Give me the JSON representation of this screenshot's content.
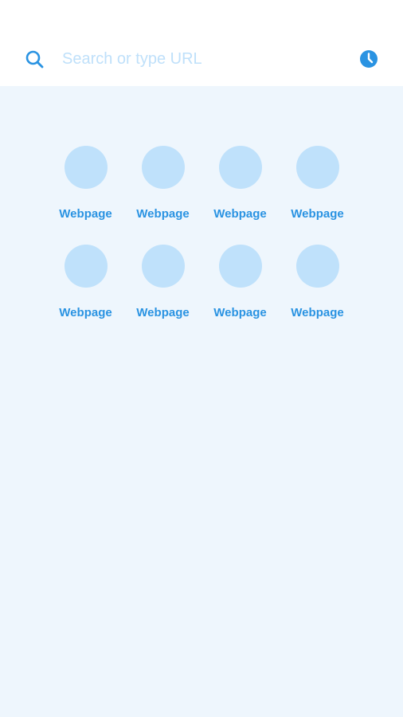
{
  "search": {
    "placeholder": "Search or type URL",
    "value": "",
    "icon": "search-icon"
  },
  "history": {
    "icon": "clock-icon"
  },
  "colors": {
    "accent": "#2a93e2",
    "background": "#eef6fd",
    "tile": "#bfe1fb",
    "placeholder": "#bfe0fa"
  },
  "shortcuts": [
    {
      "label": "Webpage"
    },
    {
      "label": "Webpage"
    },
    {
      "label": "Webpage"
    },
    {
      "label": "Webpage"
    },
    {
      "label": "Webpage"
    },
    {
      "label": "Webpage"
    },
    {
      "label": "Webpage"
    },
    {
      "label": "Webpage"
    }
  ]
}
